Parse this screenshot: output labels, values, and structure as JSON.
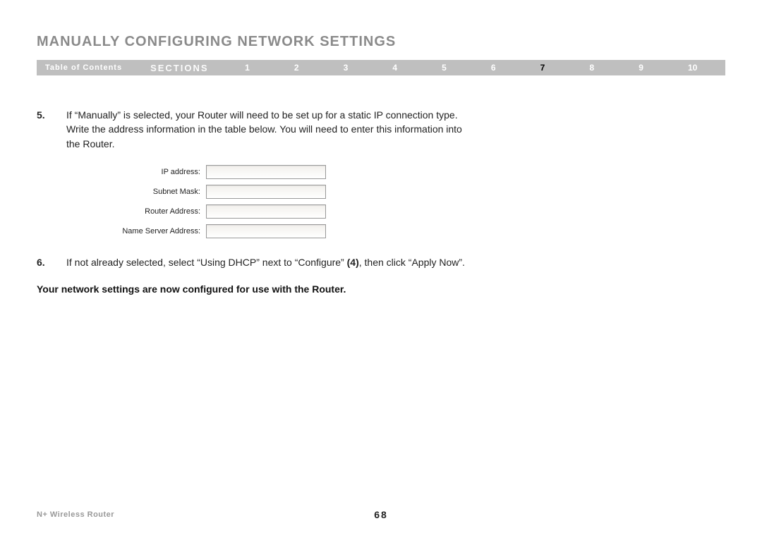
{
  "title": "MANUALLY CONFIGURING NETWORK SETTINGS",
  "nav": {
    "toc": "Table of Contents",
    "sections_label": "SECTIONS",
    "items": [
      "1",
      "2",
      "3",
      "4",
      "5",
      "6",
      "7",
      "8",
      "9",
      "10"
    ],
    "active": "7"
  },
  "steps": [
    {
      "num": "5.",
      "text": "If “Manually” is selected, your Router will need to be set up for a static IP connection type. Write the address information in the table below. You will need to enter this information into the Router."
    },
    {
      "num": "6.",
      "text_parts": {
        "a": "If not already selected, select “Using DHCP” next to “Configure” ",
        "b": "(4)",
        "c": ", then click “Apply Now”."
      }
    }
  ],
  "form": {
    "rows": [
      {
        "label": "IP address:"
      },
      {
        "label": "Subnet Mask:"
      },
      {
        "label": "Router Address:"
      },
      {
        "label": "Name Server Address:"
      }
    ]
  },
  "bold_statement": "Your network settings are now configured for use with the Router.",
  "footer": {
    "left": "N+ Wireless Router",
    "page": "68"
  }
}
